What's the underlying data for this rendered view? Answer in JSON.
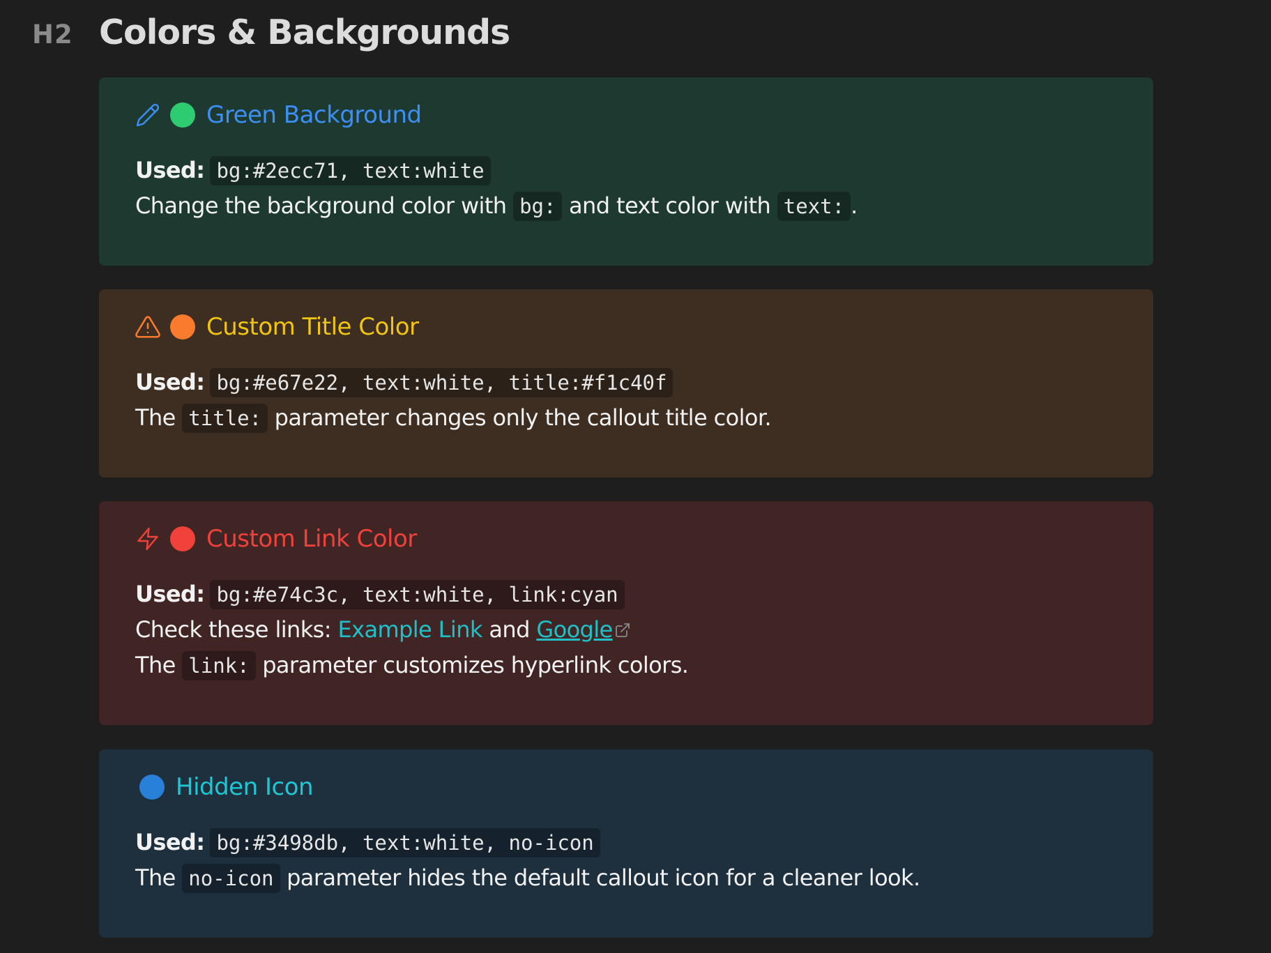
{
  "heading": {
    "level_badge": "H2",
    "title": "Colors & Backgrounds"
  },
  "callouts": [
    {
      "title": "Green Background",
      "icon": "pencil-icon",
      "dot_color": "#2ecc71",
      "bg_color": "#1e3a30",
      "title_color": "#3b8ff5",
      "used_label": "Used:",
      "used_code": "bg:#2ecc71, text:white",
      "line2": {
        "t1": "Change the background color with",
        "c1": "bg:",
        "t2": "and text color with",
        "c2": "text:",
        "t3": "."
      }
    },
    {
      "title": "Custom Title Color",
      "icon": "warning-icon",
      "dot_color": "#fa7a2e",
      "bg_color": "#3e2e22",
      "title_color": "#f1c40f",
      "used_label": "Used:",
      "used_code": "bg:#e67e22, text:white, title:#f1c40f",
      "line2": {
        "t1": "The",
        "c1": "title:",
        "t2": "parameter changes only the callout title color."
      }
    },
    {
      "title": "Custom Link Color",
      "icon": "lightning-icon",
      "dot_color": "#f0413a",
      "bg_color": "#412524",
      "title_color": "#f0413a",
      "used_label": "Used:",
      "used_code": "bg:#e74c3c, text:white, link:cyan",
      "line2": {
        "t1": "Check these links:",
        "link1": "Example Link",
        "t2": "and",
        "link2": "Google"
      },
      "line3": {
        "t1": "The",
        "c1": "link:",
        "t2": "parameter customizes hyperlink colors."
      },
      "link_color": "#1fc0c8"
    },
    {
      "title": "Hidden Icon",
      "dot_color": "#2980d9",
      "bg_color": "#1e2f3d",
      "title_color": "#1fc7d4",
      "used_label": "Used:",
      "used_code": "bg:#3498db, text:white, no-icon",
      "line2": {
        "t1": "The",
        "c1": "no-icon",
        "t2": "parameter hides the default callout icon for a cleaner look."
      }
    }
  ]
}
